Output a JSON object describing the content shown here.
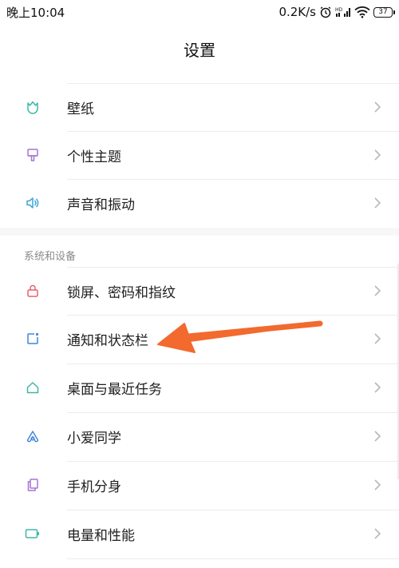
{
  "status_bar": {
    "time": "晚上10:04",
    "network_speed": "0.2K/s",
    "battery_level": "37"
  },
  "header": {
    "title": "设置"
  },
  "sections": [
    {
      "header": "",
      "items": [
        {
          "label": "壁纸",
          "icon": "wallpaper-icon",
          "color": "#3fb8a8"
        },
        {
          "label": "个性主题",
          "icon": "theme-brush-icon",
          "color": "#a574d6"
        },
        {
          "label": "声音和振动",
          "icon": "speaker-icon",
          "color": "#3fa6d9"
        }
      ]
    },
    {
      "header": "系统和设备",
      "items": [
        {
          "label": "锁屏、密码和指纹",
          "icon": "lock-icon",
          "color": "#e8606b"
        },
        {
          "label": "通知和状态栏",
          "icon": "notification-icon",
          "color": "#3f86d9"
        },
        {
          "label": "桌面与最近任务",
          "icon": "home-icon",
          "color": "#3fb8a8"
        },
        {
          "label": "小爱同学",
          "icon": "xiaoai-icon",
          "color": "#3f86d9"
        },
        {
          "label": "手机分身",
          "icon": "clone-icon",
          "color": "#a574d6"
        },
        {
          "label": "电量和性能",
          "icon": "battery-icon",
          "color": "#3fb8a8"
        }
      ]
    }
  ],
  "colors": {
    "arrow": "#f26a2e",
    "chevron": "#b8b8b8"
  }
}
